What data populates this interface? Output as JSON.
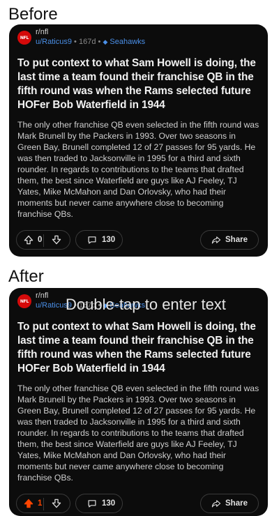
{
  "labels": {
    "before": "Before",
    "after": "After"
  },
  "overlay": {
    "text": "Double-tap to enter text"
  },
  "colors": {
    "card_bg": "#0c0c0c",
    "link_blue": "#4a8fe7",
    "upvote_active": "#ff4500",
    "avatar_red": "#d50a0a"
  },
  "post": {
    "subreddit": "r/nfl",
    "avatar_text": "NFL",
    "user": "u/Raticus9",
    "age": "167d",
    "flair": "Seahawks",
    "title": "To put context to what Sam Howell is doing, the last time a team found their franchise QB in the fifth round was when the Rams selected future HOFer Bob Waterfield in 1944",
    "body": "The only other franchise QB even selected in the fifth round was Mark Brunell by the Packers in 1993. Over two seasons in Green Bay, Brunell completed 12 of 27 passes for 95 yards. He was then traded to Jacksonville in 1995 for a third and sixth rounder. In regards to contributions to the teams that drafted them, the best since Waterfield are guys like AJ Feeley, TJ Yates, Mike McMahon and Dan Orlovsky, who had their moments but never came anywhere close to becoming franchise QBs.",
    "comments": "130",
    "share_label": "Share"
  },
  "before": {
    "votes": "0",
    "upvoted": false
  },
  "after": {
    "votes": "1",
    "upvoted": true
  },
  "icons": {
    "upvote": "upvote-arrow-icon",
    "downvote": "downvote-arrow-icon",
    "comment": "comment-bubble-icon",
    "share": "share-arrow-icon",
    "flair": "shield-icon"
  }
}
